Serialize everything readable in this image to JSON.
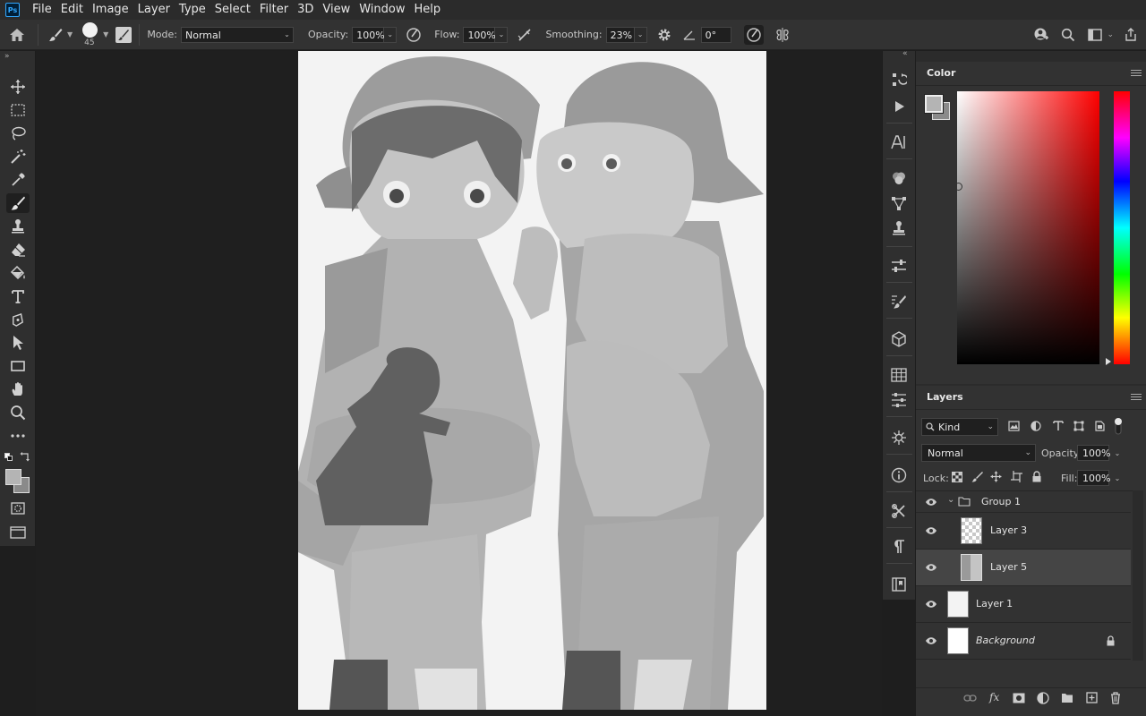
{
  "app": {
    "logo": "Ps"
  },
  "menu": [
    "File",
    "Edit",
    "Image",
    "Layer",
    "Type",
    "Select",
    "Filter",
    "3D",
    "View",
    "Window",
    "Help"
  ],
  "options": {
    "brush_size": "45",
    "mode_label": "Mode:",
    "mode_value": "Normal",
    "opacity_label": "Opacity:",
    "opacity_value": "100%",
    "flow_label": "Flow:",
    "flow_value": "100%",
    "smoothing_label": "Smoothing:",
    "smoothing_value": "23%",
    "angle_value": "0°"
  },
  "colors": {
    "foreground": "#b4b4b4",
    "background": "#8a8a8a",
    "hue_accent": "#ff0000"
  },
  "panels": {
    "color_tab": "Color",
    "layers_tab": "Layers",
    "filter_kind": "Kind",
    "blend_mode": "Normal",
    "opacity_label": "Opacity:",
    "opacity_value": "100%",
    "lock_label": "Lock:",
    "fill_label": "Fill:",
    "fill_value": "100%"
  },
  "layers": [
    {
      "name": "Group 1",
      "type": "group"
    },
    {
      "name": "Layer 3",
      "type": "layer"
    },
    {
      "name": "Layer 5",
      "type": "layer",
      "selected": true
    },
    {
      "name": "Layer 1",
      "type": "layer"
    },
    {
      "name": "Background",
      "type": "background"
    }
  ]
}
